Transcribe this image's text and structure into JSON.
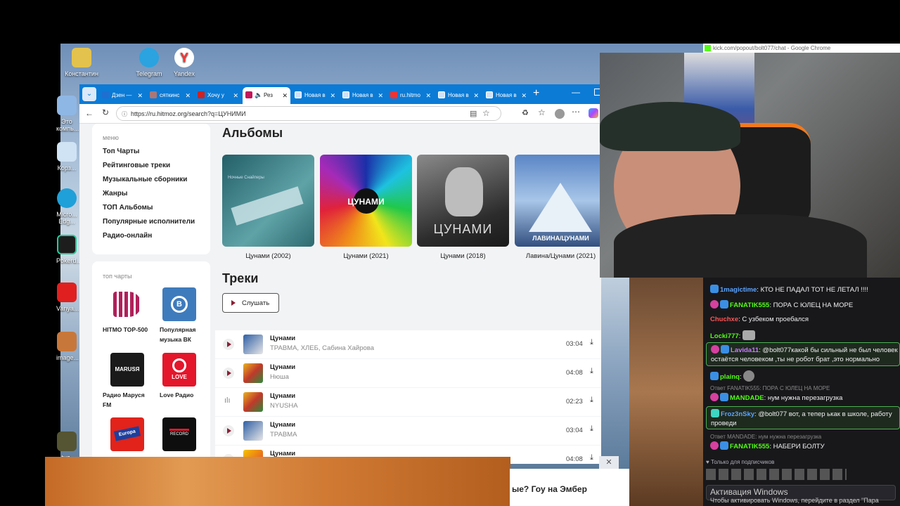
{
  "desktop": {
    "icons": [
      {
        "label": "Константин"
      },
      {
        "label": "Telegram"
      },
      {
        "label": "Yandex"
      },
      {
        "label": "Это компь..."
      },
      {
        "label": "Корз..."
      },
      {
        "label": "Micro... Edg..."
      },
      {
        "label": "Pokerd..."
      },
      {
        "label": "Vanya..."
      },
      {
        "label": "image..."
      },
      {
        "label": "tuz-ha..."
      }
    ]
  },
  "browser": {
    "tabs": [
      {
        "label": "Дзен —"
      },
      {
        "label": "сяткинс"
      },
      {
        "label": "Хочу у"
      },
      {
        "label": "Рез"
      },
      {
        "label": "Новая в"
      },
      {
        "label": "Новая в"
      },
      {
        "label": "ru.hitmo"
      },
      {
        "label": "Новая в"
      },
      {
        "label": "Новая в"
      }
    ],
    "url": "https://ru.hitmoz.org/search?q=ЦУНИМИ"
  },
  "sidebar": {
    "menu_title": "меню",
    "menu_items": [
      {
        "label": "Топ Чарты"
      },
      {
        "label": "Рейтинговые треки"
      },
      {
        "label": "Музыкальные сборники"
      },
      {
        "label": "Жанры"
      },
      {
        "label": "ТОП Альбомы"
      },
      {
        "label": "Популярные исполнители"
      },
      {
        "label": "Радио-онлайн"
      }
    ],
    "charts_title": "топ чарты",
    "charts": [
      {
        "label": "HITMO TOP-500"
      },
      {
        "label": "Популярная музыка ВК"
      },
      {
        "label": "Радио Маруся FM"
      },
      {
        "label": "Love Радио"
      },
      {
        "label": ""
      },
      {
        "label": ""
      }
    ]
  },
  "main": {
    "albums_title": "Альбомы",
    "albums": [
      {
        "label": "Цунами (2002)",
        "color": "#2e6f78"
      },
      {
        "label": "Цунами (2021)",
        "color": "#8a2c8f"
      },
      {
        "label": "Цунами (2018)",
        "color": "#555555"
      },
      {
        "label": "Лавина/Цунами (2021)",
        "color": "#4e78b5"
      }
    ],
    "tracks_title": "Треки",
    "listen_label": "Слушать",
    "tracks": [
      {
        "title": "Цунами",
        "artist": "ТРАВМА, ХЛЕБ, Сабина Хайрова",
        "duration": "03:04"
      },
      {
        "title": "Цунами",
        "artist": "Нюша",
        "duration": "04:08"
      },
      {
        "title": "Цунами",
        "artist": "NYUSHA",
        "duration": "02:23"
      },
      {
        "title": "Цунами",
        "artist": "ТРАВМА",
        "duration": "03:04"
      },
      {
        "title": "Цунами",
        "artist": "",
        "duration": "04:08"
      }
    ]
  },
  "ad": {
    "text": "ые? Гоу на Эмбер"
  },
  "kick": {
    "title": "kick.com/popout/bolt077/chat - Google Chrome"
  },
  "chat": {
    "messages": [
      {
        "user": "1magictime",
        "color": "#5ba3ff",
        "text": "КТО НЕ ПАДАЛ ТОТ НЕ ЛЕТАЛ !!!!"
      },
      {
        "user": "FANATIK555",
        "color": "#53fc18",
        "text": "ПОРА С ЮЛЕЦ НА МОРЕ"
      },
      {
        "user": "Chuchxe",
        "color": "#ff5555",
        "text": "С узбеком проебался"
      },
      {
        "user": "Locki777",
        "color": "#53fc18",
        "text": ""
      },
      {
        "user": "Lavida11",
        "color": "#c77dff",
        "text": "@bolt077какой бы сильный не был человек",
        "text2": "остаётся человеком ,ты не робот брат ,это нормально"
      },
      {
        "user": "plainq",
        "color": "#53fc18",
        "text": ""
      },
      {
        "reply": "Ответ FANATIK555: ПОРА С ЮЛЕЦ НА МОРЕ"
      },
      {
        "user": "MANDADE",
        "color": "#53fc18",
        "text": "нум нужна перезагрузка"
      },
      {
        "user": "Froz3nSky",
        "color": "#5ba3ff",
        "text": "@bolt077 вот, а тепер ькак в школе, работу",
        "text2": "проведи"
      },
      {
        "reply": "Ответ MANDADE: нум нужна перезагрузка"
      },
      {
        "user": "FANATIK555",
        "color": "#53fc18",
        "text": "НАБЕРИ БОЛТУ"
      }
    ],
    "subs_only": "Только для подписчиков"
  },
  "windows": {
    "activation": "Активация Windows",
    "activation_sub": "Чтобы активировать Windows, перейдите в раздел \"Пара"
  }
}
